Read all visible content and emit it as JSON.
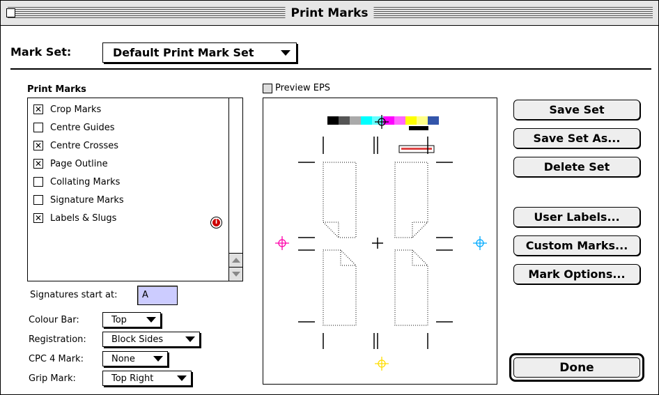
{
  "window": {
    "title": "Print Marks"
  },
  "mark_set": {
    "label": "Mark Set:",
    "value": "Default Print Mark Set"
  },
  "print_marks": {
    "title": "Print Marks",
    "items": [
      {
        "label": "Crop Marks",
        "checked": true
      },
      {
        "label": "Centre Guides",
        "checked": false
      },
      {
        "label": "Centre Crosses",
        "checked": true
      },
      {
        "label": "Page Outline",
        "checked": true
      },
      {
        "label": "Collating Marks",
        "checked": false
      },
      {
        "label": "Signature Marks",
        "checked": false
      },
      {
        "label": "Labels & Slugs",
        "checked": true
      }
    ]
  },
  "signatures": {
    "label": "Signatures start at:",
    "value": "A"
  },
  "colour_bar": {
    "label": "Colour Bar:",
    "value": "Top"
  },
  "registration": {
    "label": "Registration:",
    "value": "Block Sides"
  },
  "cpc4": {
    "label": "CPC 4 Mark:",
    "value": "None"
  },
  "grip": {
    "label": "Grip Mark:",
    "value": "Top Right"
  },
  "preview": {
    "label": "Preview EPS",
    "checked": false
  },
  "buttons": {
    "save_set": "Save Set",
    "save_set_as": "Save Set As...",
    "delete_set": "Delete Set",
    "user_labels": "User Labels...",
    "custom_marks": "Custom Marks...",
    "mark_options": "Mark Options...",
    "done": "Done"
  },
  "colors": {
    "colour_bar": [
      "#000000",
      "#555555",
      "#aaaaaa",
      "#00ffff",
      "#66ffff",
      "#ff00ff",
      "#ff66ff",
      "#ffff00",
      "#ffff88",
      "#3355aa"
    ],
    "registration_magenta": "#ff00aa",
    "registration_cyan": "#00aaff",
    "registration_yellow": "#ffdd00",
    "label_slug": "#dd4444"
  },
  "icons": {
    "info": "info-icon",
    "check": "x-check-icon"
  }
}
